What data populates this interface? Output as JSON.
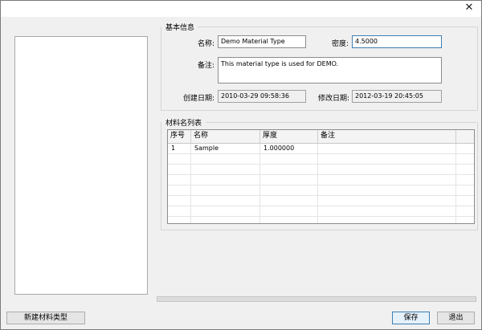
{
  "window": {
    "close_glyph": "✕"
  },
  "basic_info": {
    "section_title": "基本信息",
    "name_label": "名称:",
    "name_value": "Demo Material Type",
    "density_label": "密度:",
    "density_value": "4.5000",
    "remark_label": "备注:",
    "remark_value": "This material type is used for DEMO.",
    "created_label": "创建日期:",
    "created_value": "2010-03-29 09:58:36",
    "modified_label": "修改日期:",
    "modified_value": "2012-03-19 20:45:05"
  },
  "material_list": {
    "section_title": "材料名列表",
    "columns": [
      "序号",
      "名称",
      "厚度",
      "备注"
    ],
    "rows": [
      {
        "index": "1",
        "name": "Sample",
        "thickness": "1.000000",
        "remark": ""
      }
    ]
  },
  "buttons": {
    "new_type": "新建材料类型",
    "save": "保存",
    "exit": "退出"
  }
}
